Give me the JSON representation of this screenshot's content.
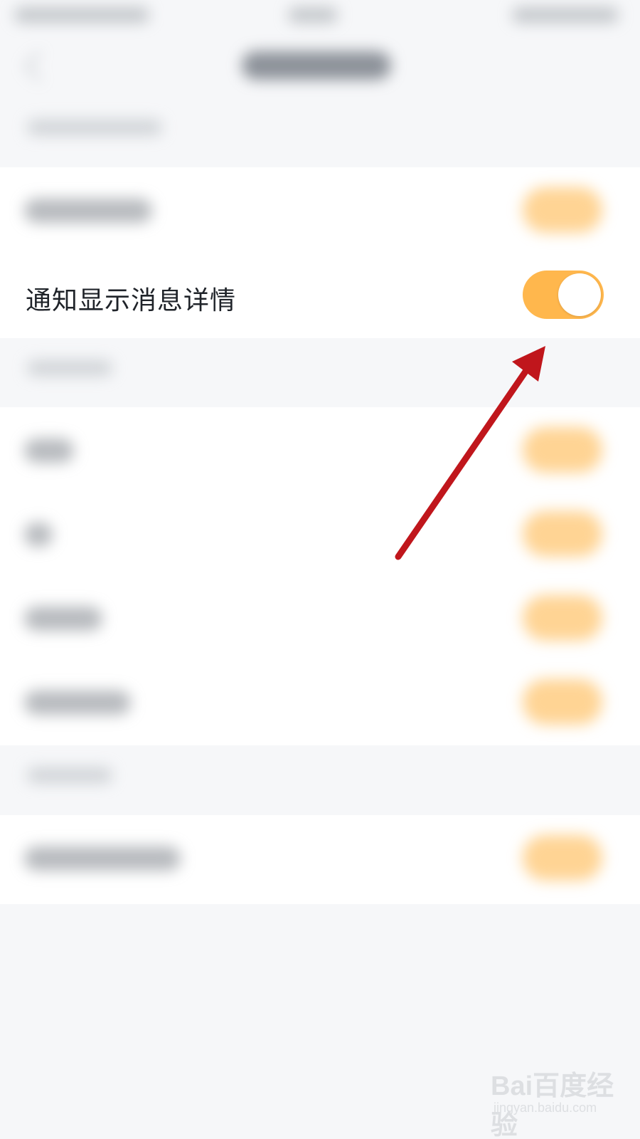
{
  "focus_setting": {
    "label": "通知显示消息详情",
    "enabled": true
  },
  "colors": {
    "accent": "#ffb74d",
    "background": "#f6f7f9",
    "card": "#ffffff",
    "arrow": "#c0161c"
  },
  "watermark": {
    "brand": "Bai百度经验",
    "sub": "jingyan.baidu.com"
  }
}
